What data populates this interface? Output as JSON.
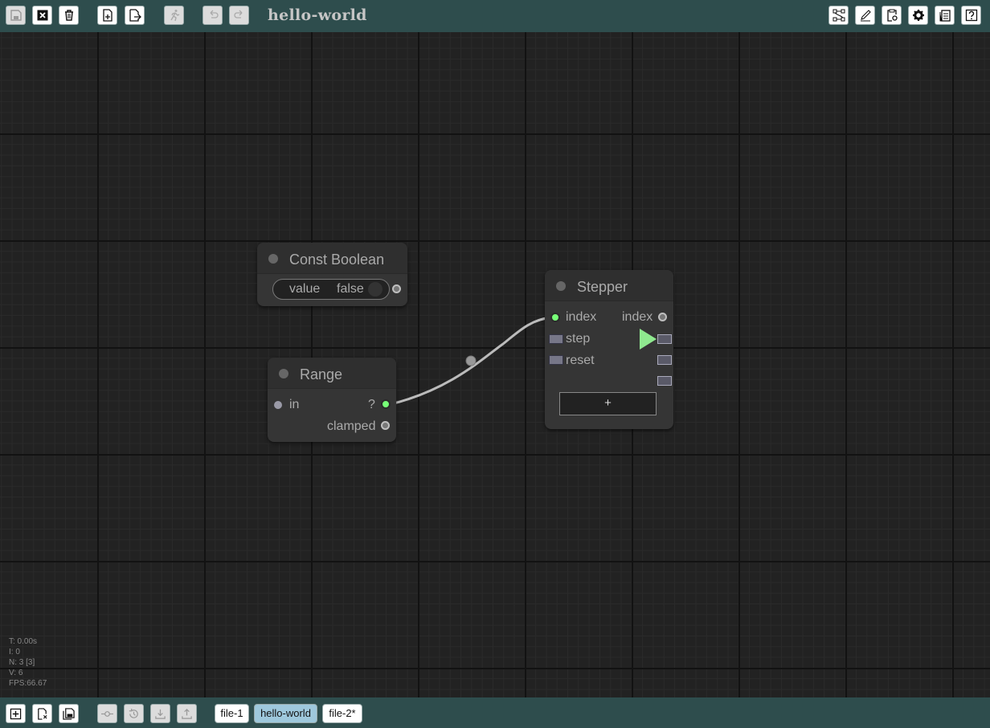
{
  "app": {
    "title": "hello-world"
  },
  "toolbar_left": [
    {
      "name": "save-icon",
      "disabled": true
    },
    {
      "name": "close-icon",
      "disabled": false
    },
    {
      "name": "trash-icon",
      "disabled": false
    },
    {
      "name": "new-file-icon",
      "disabled": false
    },
    {
      "name": "export-file-icon",
      "disabled": false
    },
    {
      "name": "run-icon",
      "disabled": true
    },
    {
      "name": "undo-icon",
      "disabled": true
    },
    {
      "name": "redo-icon",
      "disabled": true
    }
  ],
  "toolbar_right": [
    {
      "name": "graph-layout-icon"
    },
    {
      "name": "edit-icon"
    },
    {
      "name": "clipboard-settings-icon"
    },
    {
      "name": "gear-icon"
    },
    {
      "name": "document-copy-icon"
    },
    {
      "name": "help-icon"
    }
  ],
  "nodes": {
    "const_boolean": {
      "title": "Const Boolean",
      "widget_label": "value",
      "widget_value": "false"
    },
    "range": {
      "title": "Range",
      "input_in": "in",
      "output_value": "?",
      "output_clamped": "clamped"
    },
    "stepper": {
      "title": "Stepper",
      "input_index": "index",
      "output_index": "index",
      "input_step": "step",
      "input_reset": "reset",
      "add_label": "+"
    }
  },
  "stats": {
    "time": "T: 0.00s",
    "iterations": "I: 0",
    "nodes": "N: 3 [3]",
    "visible": "V: 6",
    "fps": "FPS:66.67"
  },
  "bottom_tools": [
    {
      "name": "add-node-icon",
      "disabled": false
    },
    {
      "name": "file-delete-icon",
      "disabled": false
    },
    {
      "name": "save-all-icon",
      "disabled": false
    },
    {
      "name": "commit-icon",
      "disabled": true
    },
    {
      "name": "revert-icon",
      "disabled": true
    },
    {
      "name": "download-icon",
      "disabled": true
    },
    {
      "name": "upload-icon",
      "disabled": true
    }
  ],
  "file_tabs": [
    {
      "label": "file-1",
      "active": false
    },
    {
      "label": "hello-world",
      "active": true
    },
    {
      "label": "file-2*",
      "active": false
    }
  ],
  "colors": {
    "toolbar": "#2e4d4d",
    "canvas": "#222222",
    "node": "#353535",
    "active_slot": "#77ff77",
    "active_tab": "#9ec8dc"
  }
}
